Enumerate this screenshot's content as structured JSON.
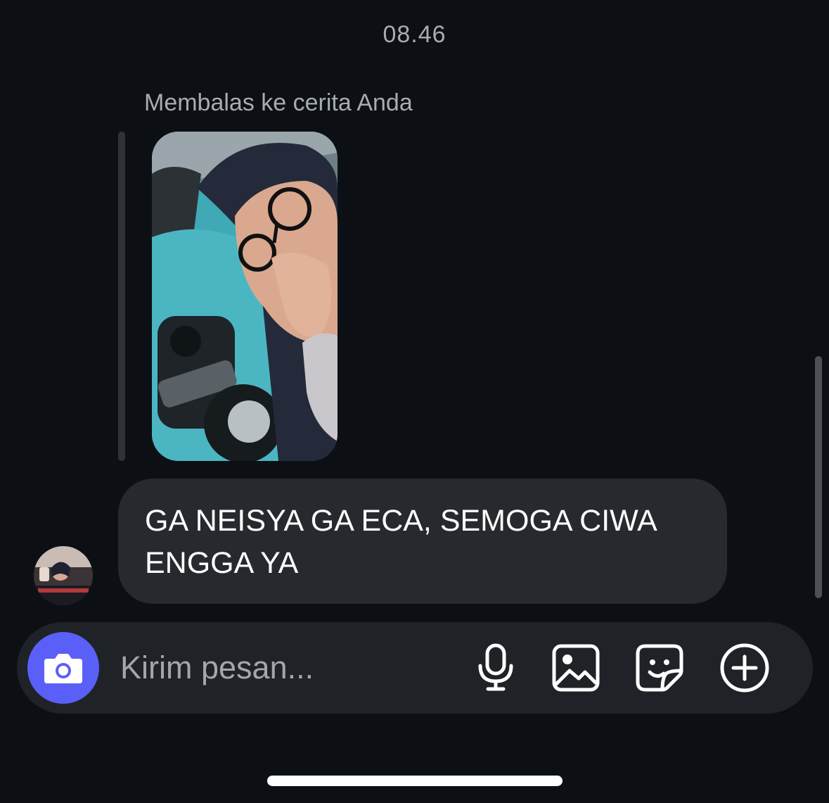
{
  "thread": {
    "timestamp": "08.46",
    "reply_context": "Membalas ke cerita Anda"
  },
  "message": {
    "text": "GA NEISYA GA ECA, SEMOGA CIWA ENGGA YA"
  },
  "composer": {
    "placeholder": "Kirim pesan...",
    "icons": [
      "camera-icon",
      "microphone-icon",
      "gallery-icon",
      "sticker-icon",
      "add-icon"
    ]
  },
  "colors": {
    "background": "#0c1014",
    "bubble": "#262a2f",
    "composer": "#1f2327",
    "camera_button": "#5a5ff7",
    "secondary_text": "#a8acb2"
  }
}
